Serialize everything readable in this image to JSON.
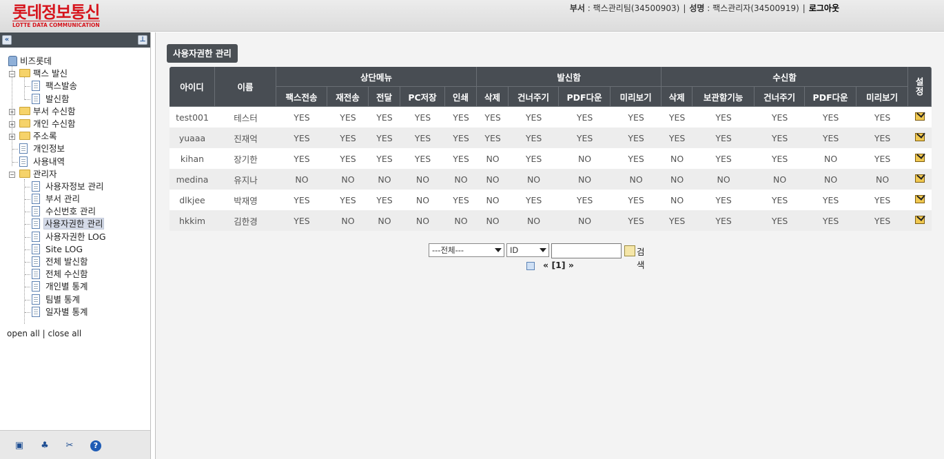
{
  "header": {
    "logo_ko": "롯데정보통신",
    "logo_en": "LOTTE DATA COMMUNICATION",
    "dept_label": "부서",
    "dept_value": "팩스관리팀(34500903)",
    "name_label": "성명",
    "name_value": "팩스관리자(34500919)",
    "logout": "로그아웃"
  },
  "sidebar": {
    "root": "비즈롯데",
    "items": [
      {
        "label": "팩스 발신"
      },
      {
        "label": "팩스발송"
      },
      {
        "label": "발신함"
      },
      {
        "label": "부서 수신함"
      },
      {
        "label": "개인 수신함"
      },
      {
        "label": "주소록"
      },
      {
        "label": "개인정보"
      },
      {
        "label": "사용내역"
      },
      {
        "label": "관리자"
      },
      {
        "label": "사용자정보 관리"
      },
      {
        "label": "부서 관리"
      },
      {
        "label": "수신번호 관리"
      },
      {
        "label": "사용자권한 관리"
      },
      {
        "label": "사용자권한 LOG"
      },
      {
        "label": "Site LOG"
      },
      {
        "label": "전체 발신함"
      },
      {
        "label": "전체 수신함"
      },
      {
        "label": "개인별 통계"
      },
      {
        "label": "팀별 통계"
      },
      {
        "label": "일자별 통계"
      }
    ],
    "open_all": "open all",
    "close_all": "close all"
  },
  "main": {
    "title": "사용자권한 관리",
    "headers": {
      "id": "아이디",
      "name": "이름",
      "group1": "상단메뉴",
      "group2": "발신함",
      "group3": "수신함",
      "settings": "설정",
      "sub": [
        "팩스전송",
        "재전송",
        "전달",
        "PC저장",
        "인쇄",
        "삭제",
        "건너주기",
        "PDF다운",
        "미리보기",
        "삭제",
        "보관함기능",
        "건너주기",
        "PDF다운",
        "미리보기"
      ]
    },
    "rows": [
      {
        "id": "test001",
        "name": "테스터",
        "perms": [
          "YES",
          "YES",
          "YES",
          "YES",
          "YES",
          "YES",
          "YES",
          "YES",
          "YES",
          "YES",
          "YES",
          "YES",
          "YES",
          "YES"
        ]
      },
      {
        "id": "yuaaa",
        "name": "진재억",
        "perms": [
          "YES",
          "YES",
          "YES",
          "YES",
          "YES",
          "YES",
          "YES",
          "YES",
          "YES",
          "YES",
          "YES",
          "YES",
          "YES",
          "YES"
        ]
      },
      {
        "id": "kihan",
        "name": "장기한",
        "perms": [
          "YES",
          "YES",
          "YES",
          "YES",
          "YES",
          "NO",
          "YES",
          "NO",
          "YES",
          "NO",
          "YES",
          "YES",
          "NO",
          "YES"
        ]
      },
      {
        "id": "medina",
        "name": "유지나",
        "perms": [
          "NO",
          "NO",
          "NO",
          "NO",
          "NO",
          "NO",
          "NO",
          "NO",
          "NO",
          "NO",
          "NO",
          "NO",
          "NO",
          "NO"
        ]
      },
      {
        "id": "dlkjee",
        "name": "박재영",
        "perms": [
          "YES",
          "YES",
          "YES",
          "NO",
          "YES",
          "NO",
          "YES",
          "YES",
          "YES",
          "NO",
          "YES",
          "YES",
          "YES",
          "YES"
        ]
      },
      {
        "id": "hkkim",
        "name": "김한경",
        "perms": [
          "YES",
          "NO",
          "NO",
          "NO",
          "NO",
          "NO",
          "NO",
          "NO",
          "YES",
          "YES",
          "YES",
          "YES",
          "YES",
          "YES"
        ]
      }
    ],
    "search": {
      "scope": "---전체---",
      "field": "ID",
      "query": "",
      "button": "검색"
    },
    "pager": "[1]"
  }
}
